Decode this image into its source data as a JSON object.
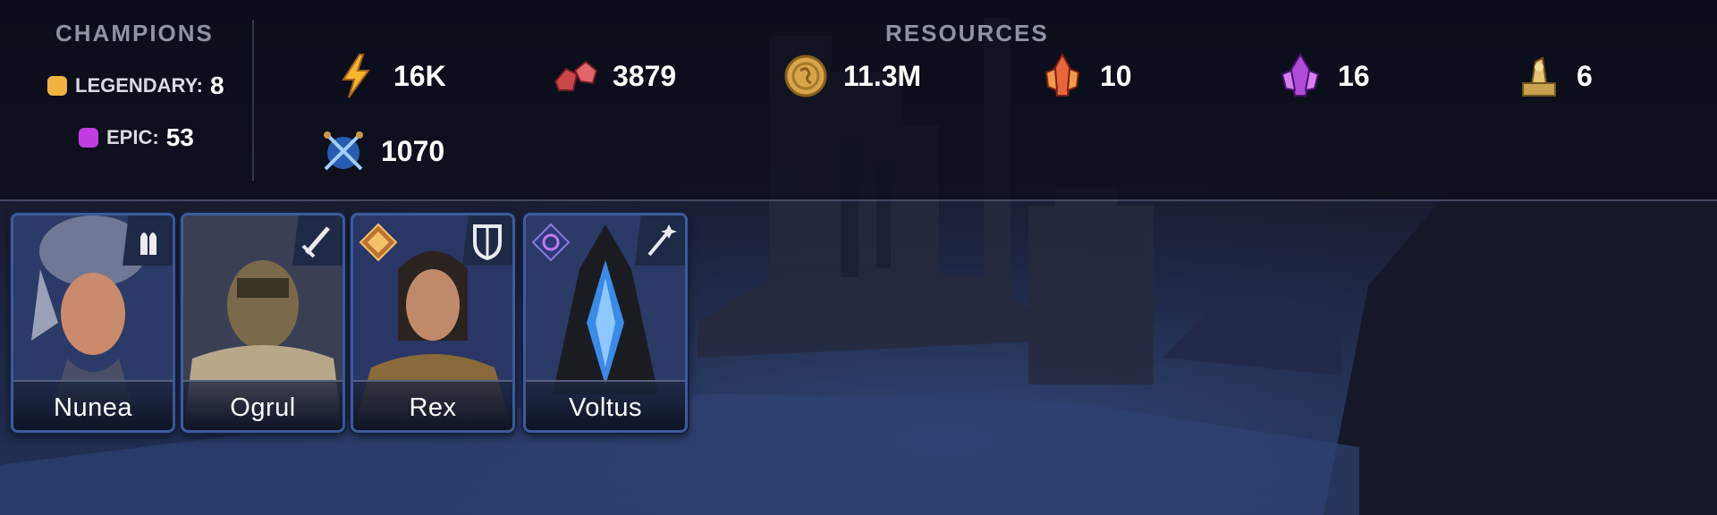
{
  "champions": {
    "title": "CHAMPIONS",
    "legendary": {
      "label": "LEGENDARY:",
      "count": "8",
      "color": "#f0b340"
    },
    "epic": {
      "label": "EPIC:",
      "count": "53",
      "color": "#c03ee0"
    }
  },
  "resources": {
    "title": "RESOURCES",
    "items": [
      {
        "icon": "energy-icon",
        "value": "16K"
      },
      {
        "icon": "gem-shards-icon",
        "value": "3879"
      },
      {
        "icon": "silver-coin-icon",
        "value": "11.3M"
      },
      {
        "icon": "sacred-shard-icon",
        "value": "10"
      },
      {
        "icon": "void-shard-icon",
        "value": "16"
      },
      {
        "icon": "ancient-shard-icon",
        "value": "6"
      },
      {
        "icon": "arena-token-icon",
        "value": "1070"
      }
    ]
  },
  "cards": [
    {
      "name": "Nunea",
      "role_icon": "support-hands-icon",
      "affinity_icon": ""
    },
    {
      "name": "Ogrul",
      "role_icon": "sword-attack-icon",
      "affinity_icon": ""
    },
    {
      "name": "Rex",
      "role_icon": "shield-defense-icon",
      "affinity_icon": "force-affinity-icon"
    },
    {
      "name": "Voltus",
      "role_icon": "magic-wand-icon",
      "affinity_icon": "void-affinity-icon"
    }
  ]
}
